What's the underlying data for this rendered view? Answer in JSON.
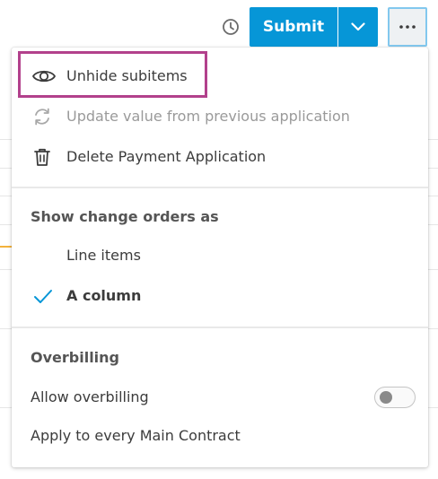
{
  "toolbar": {
    "submit_label": "Submit",
    "history_icon": "history-clock-icon",
    "dropdown_icon": "chevron-down-icon",
    "more_icon": "more-horizontal-icon"
  },
  "menu": {
    "actions": [
      {
        "label": "Unhide subitems",
        "icon": "eye-icon",
        "disabled": false,
        "highlighted": true
      },
      {
        "label": "Update value from previous application",
        "icon": "refresh-icon",
        "disabled": true
      },
      {
        "label": "Delete Payment Application",
        "icon": "trash-icon",
        "disabled": false
      }
    ],
    "change_orders": {
      "title": "Show change orders as",
      "options": [
        {
          "label": "Line items",
          "selected": false
        },
        {
          "label": "A column",
          "selected": true
        }
      ]
    },
    "overbilling": {
      "title": "Overbilling",
      "allow_label": "Allow overbilling",
      "allow_enabled": false,
      "apply_label": "Apply to every Main Contract"
    }
  },
  "colors": {
    "primary": "#0696d7",
    "highlight": "#b2418c",
    "check": "#0696d7"
  }
}
